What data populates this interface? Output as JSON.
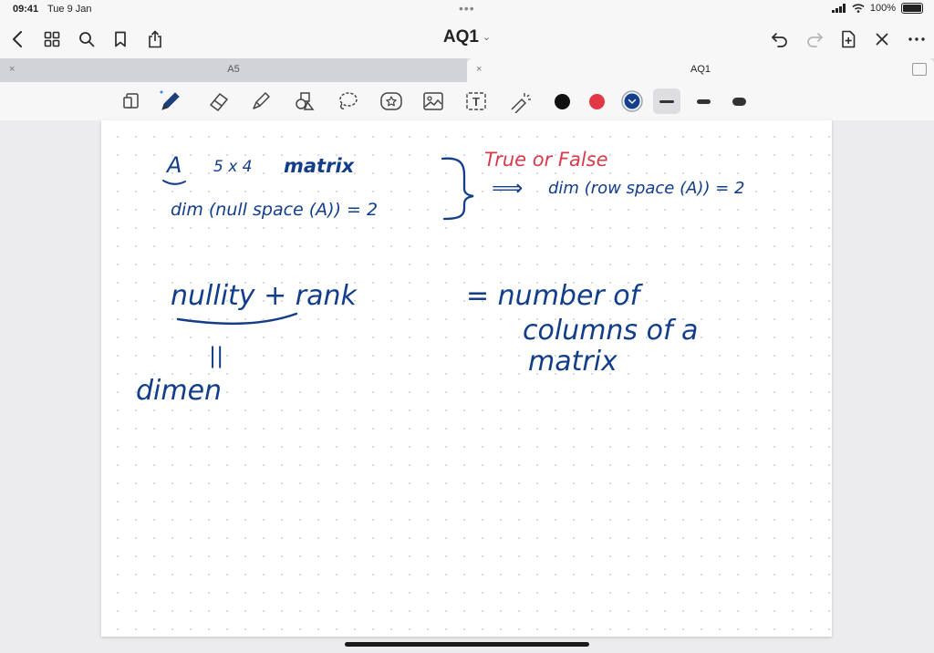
{
  "status": {
    "time": "09:41",
    "date": "Tue 9 Jan",
    "battery": "100%"
  },
  "title": {
    "text": "AQ1",
    "chevron": "⌄"
  },
  "tabs": [
    {
      "label": "A5",
      "close": "×",
      "active": false
    },
    {
      "label": "AQ1",
      "close": "×",
      "active": true
    }
  ],
  "toolbar": {
    "tools": [
      "page-view-icon",
      "pen-icon",
      "eraser-icon",
      "highlighter-icon",
      "shapes-icon",
      "lasso-icon",
      "sticker-icon",
      "image-icon",
      "text-icon",
      "laser-pointer-icon"
    ],
    "text_tool_label": "T",
    "colors": {
      "black": "#111111",
      "red": "#e23845",
      "blue": "#143f8c"
    },
    "selected_color": "blue"
  },
  "notes": {
    "line1_a": "A",
    "line1_size": "5 x 4",
    "line1_word": "matrix",
    "line2": "dim (null space (A)) = 2",
    "true_false": "True or False",
    "arrow": "⟹",
    "right_expr": "dim (row space (A)) = 2",
    "eq_left": "nullity + rank",
    "eq_right_1": "= number of",
    "eq_right_2": "columns of a",
    "eq_right_3": "matrix",
    "parallel": "||",
    "dimen": "dimen"
  }
}
